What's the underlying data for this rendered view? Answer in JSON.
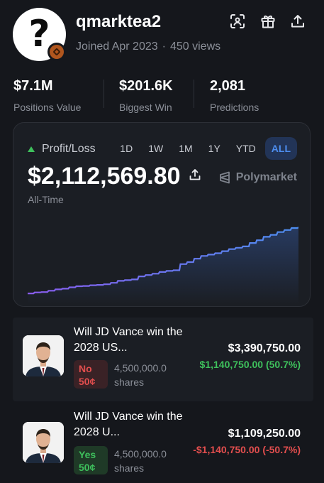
{
  "profile": {
    "username": "qmarktea2",
    "avatar_glyph": "?",
    "joined": "Joined Apr 2023",
    "views": "450 views",
    "separator": "·"
  },
  "header_icons": [
    "scan-icon",
    "gift-icon",
    "share-icon"
  ],
  "stats": [
    {
      "value": "$7.1M",
      "label": "Positions Value"
    },
    {
      "value": "$201.6K",
      "label": "Biggest Win"
    },
    {
      "value": "2,081",
      "label": "Predictions"
    }
  ],
  "pnl_card": {
    "label": "Profit/Loss",
    "ranges": [
      "1D",
      "1W",
      "1M",
      "1Y",
      "YTD",
      "ALL"
    ],
    "active_range": "ALL",
    "value": "$2,112,569.80",
    "subtitle": "All-Time",
    "brand": "Polymarket",
    "colors": {
      "up": "#3ec05c",
      "line_start": "#8a5cf0",
      "line_end": "#4d8ef0"
    }
  },
  "chart_data": {
    "type": "area",
    "title": "",
    "xlabel": "",
    "ylabel": "",
    "y_relative": [
      0.03,
      0.045,
      0.05,
      0.07,
      0.09,
      0.1,
      0.12,
      0.135,
      0.14,
      0.15,
      0.155,
      0.165,
      0.185,
      0.215,
      0.225,
      0.235,
      0.28,
      0.3,
      0.32,
      0.345,
      0.36,
      0.37,
      0.46,
      0.49,
      0.54,
      0.58,
      0.6,
      0.62,
      0.65,
      0.68,
      0.7,
      0.72,
      0.77,
      0.81,
      0.86,
      0.89,
      0.93,
      0.96,
      0.99,
      1.0
    ]
  },
  "positions": [
    {
      "title": "Will JD Vance win the 2028 US...",
      "outcome": "No",
      "price": "50¢",
      "shares_num": "4,500,000.0",
      "shares_unit": "shares",
      "amount": "$3,390,750.00",
      "pnl": "$1,140,750.00 (50.7%)"
    },
    {
      "title": "Will JD Vance win the 2028 U...",
      "outcome": "Yes",
      "price": "50¢",
      "shares_num": "4,500,000.0",
      "shares_unit": "shares",
      "amount": "$1,109,250.00",
      "pnl": "-$1,140,750.00 (-50.7%)"
    }
  ]
}
